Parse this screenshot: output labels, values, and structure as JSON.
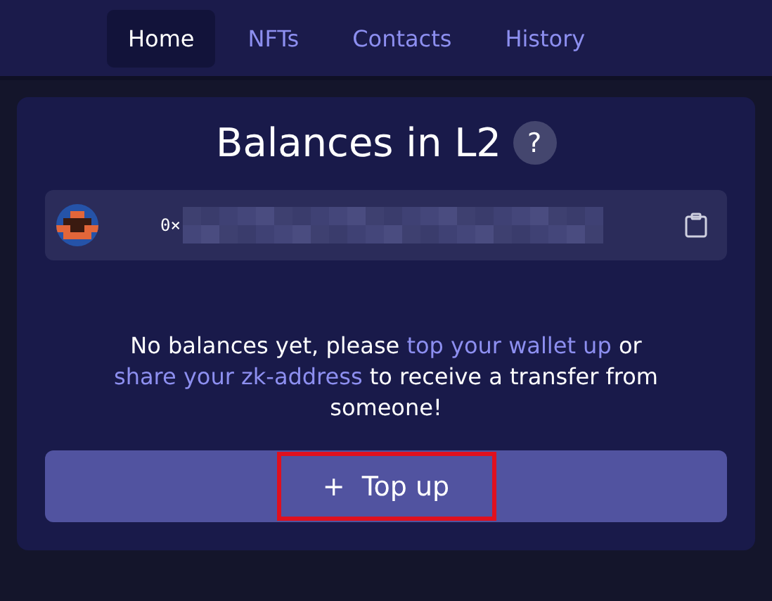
{
  "nav": {
    "tabs": [
      {
        "label": "Home",
        "selected": true
      },
      {
        "label": "NFTs",
        "selected": false
      },
      {
        "label": "Contacts",
        "selected": false
      },
      {
        "label": "History",
        "selected": false
      }
    ]
  },
  "card": {
    "title": "Balances in L2",
    "help": "?",
    "address": {
      "prefix": "0×"
    },
    "message": [
      {
        "kind": "text",
        "text": "No balances yet, please "
      },
      {
        "kind": "link",
        "text": "top your wallet up"
      },
      {
        "kind": "text",
        "text": " or "
      },
      {
        "kind": "link",
        "text": "share your zk-address"
      },
      {
        "kind": "text",
        "text": " to receive a transfer from someone!"
      }
    ],
    "button": {
      "icon": "+",
      "label": "Top up",
      "highlighted": true
    }
  }
}
